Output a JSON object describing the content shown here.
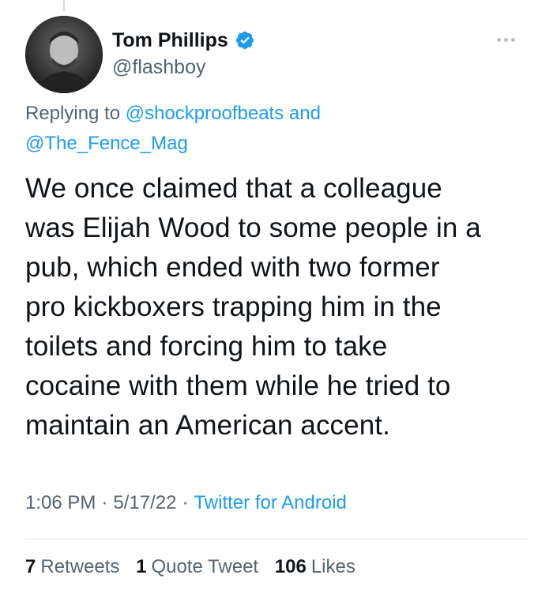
{
  "author": {
    "display_name": "Tom Phillips",
    "handle": "@flashboy",
    "verified": true
  },
  "replying": {
    "prefix": "Replying to",
    "mention1": "@shockproofbeats",
    "connector": "and",
    "mention2": "@The_Fence_Mag"
  },
  "tweet": {
    "lines": [
      "We once claimed that a colleague",
      "was Elijah Wood to some people in a",
      "pub, which ended with two former",
      "pro kickboxers trapping him in the",
      "toilets and forcing him to take",
      "cocaine with them while he tried to",
      "maintain an American accent."
    ]
  },
  "meta": {
    "time": "1:06 PM",
    "date": "5/17/22",
    "separator": "·",
    "source": "Twitter for Android"
  },
  "stats": {
    "retweets_count": "7",
    "retweets_label": "Retweets",
    "quotes_count": "1",
    "quotes_label": "Quote Tweet",
    "likes_count": "106",
    "likes_label": "Likes"
  },
  "colors": {
    "link": "#1d9bf0",
    "secondary_text": "#536471",
    "primary_text": "#0f1419"
  },
  "icons": [
    "verified-badge-icon",
    "more-options-icon",
    "avatar"
  ]
}
